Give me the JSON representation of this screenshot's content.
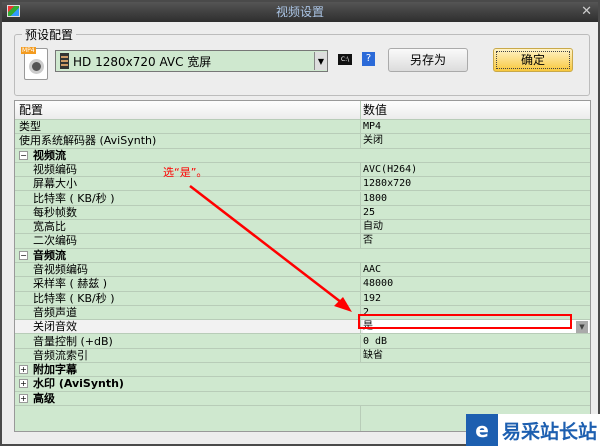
{
  "title": "视频设置",
  "preset": {
    "label": "预设配置",
    "icon_tag": "MP4",
    "selected": "HD 1280x720 AVC 宽屏",
    "cmd_icon": "C:\\",
    "help": "?",
    "saveas": "另存为",
    "ok": "确定"
  },
  "table": {
    "headers": [
      "配置",
      "数值"
    ],
    "rows": [
      {
        "k": "类型",
        "v": "MP4"
      },
      {
        "k": "使用系统解码器 (AviSynth)",
        "v": "关闭"
      },
      {
        "group": "视频流",
        "toggle": "−"
      },
      {
        "k": "视频编码",
        "v": "AVC(H264)"
      },
      {
        "k": "屏幕大小",
        "v": "1280x720"
      },
      {
        "k": "比特率 ( KB/秒 )",
        "v": "1800"
      },
      {
        "k": "每秒帧数",
        "v": "25"
      },
      {
        "k": "宽高比",
        "v": "自动"
      },
      {
        "k": "二次编码",
        "v": "否"
      },
      {
        "group": "音频流",
        "toggle": "−"
      },
      {
        "k": "音视频编码",
        "v": "AAC"
      },
      {
        "k": "采样率 ( 赫兹 )",
        "v": "48000"
      },
      {
        "k": "比特率 ( KB/秒 )",
        "v": "192"
      },
      {
        "k": "音频声道",
        "v": "2"
      },
      {
        "k": "关闭音效",
        "v": "是",
        "selected": true
      },
      {
        "k": "音量控制 (+dB)",
        "v": "0 dB"
      },
      {
        "k": "音频流索引",
        "v": "缺省"
      },
      {
        "group": "附加字幕",
        "toggle": "+"
      },
      {
        "group": "水印 (AviSynth)",
        "toggle": "+"
      },
      {
        "group": "高级",
        "toggle": "+"
      }
    ]
  },
  "annotation": "选“是”。",
  "watermark": {
    "logo": "e",
    "text": "易采站长站"
  },
  "colors": {
    "grid": "#cfe8cf",
    "annotation": "#ff0000"
  }
}
